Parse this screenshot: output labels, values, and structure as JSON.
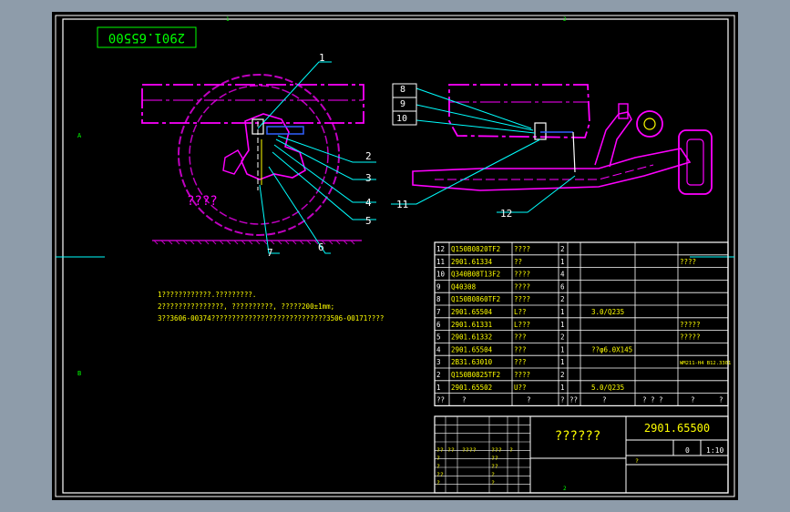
{
  "title_box": "2901.65500",
  "grid": {
    "top": [
      "1",
      "2"
    ],
    "left": [
      "A",
      "B"
    ],
    "bottom": [
      "2"
    ]
  },
  "callouts_left": [
    "1",
    "2",
    "3",
    "4",
    "5",
    "6",
    "7"
  ],
  "callouts_right": [
    "8",
    "9",
    "10",
    "11",
    "12"
  ],
  "wheel_label": "????",
  "notes": [
    "1????????????.?????????.",
    "2???????????????, ??????????,   ?????200±1mm;",
    "3??3606-00374????????????????????????????3506-00171????"
  ],
  "bom": [
    {
      "no": "12",
      "code": "Q150B0820TF2",
      "name": "????",
      "qty": "2",
      "mat": "",
      "note": ""
    },
    {
      "no": "11",
      "code": "2901.61334",
      "name": "??",
      "qty": "1",
      "mat": "",
      "note": "????"
    },
    {
      "no": "10",
      "code": "Q340B08T13F2",
      "name": "????",
      "qty": "4",
      "mat": "",
      "note": ""
    },
    {
      "no": "9",
      "code": "Q40308",
      "name": "????",
      "qty": "6",
      "mat": "",
      "note": ""
    },
    {
      "no": "8",
      "code": "Q150B0860TF2",
      "name": "????",
      "qty": "2",
      "mat": "",
      "note": ""
    },
    {
      "no": "7",
      "code": "2901.65504",
      "name": "L??",
      "qty": "1",
      "mat": "3.0/Q235",
      "note": ""
    },
    {
      "no": "6",
      "code": "2901.61331",
      "name": "L???",
      "qty": "1",
      "mat": "",
      "note": "?????"
    },
    {
      "no": "5",
      "code": "2901.61332",
      "name": "???",
      "qty": "2",
      "mat": "",
      "note": "?????"
    },
    {
      "no": "4",
      "code": "2901.65504",
      "name": "???",
      "qty": "1",
      "mat": "??φ6.0X145",
      "note": ""
    },
    {
      "no": "3",
      "code": "2B31.63010",
      "name": "???",
      "qty": "1",
      "mat": "",
      "note": "WM211-H4 B12.3301"
    },
    {
      "no": "2",
      "code": "Q150B0825TF2",
      "name": "????",
      "qty": "2",
      "mat": "",
      "note": ""
    },
    {
      "no": "1",
      "code": "2901.65502",
      "name": "U??",
      "qty": "1",
      "mat": "5.0/Q235",
      "note": ""
    }
  ],
  "bom_header": [
    "??",
    "?",
    "?",
    "?",
    "??",
    "?",
    "? ? ?\n? ? ?",
    "?",
    "?"
  ],
  "title_name": "??????",
  "drawing_no": "2901.65500",
  "scale": "1:10",
  "sheet_num": "0",
  "tb_small": [
    "??",
    "??",
    "????",
    "???",
    "?",
    "?",
    "?",
    "??",
    "??",
    "??",
    "?",
    "?",
    "?",
    "?"
  ]
}
